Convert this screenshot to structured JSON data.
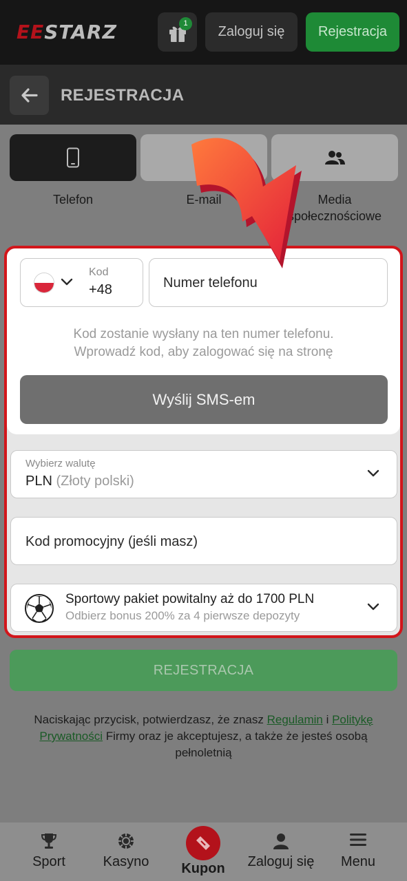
{
  "topbar": {
    "logo_red": "EE",
    "logo_text": "STARZ",
    "gift_badge": "1",
    "login_label": "Zaloguj się",
    "register_label": "Rejestracja"
  },
  "header": {
    "title": "REJESTRACJA"
  },
  "tabs": [
    {
      "label": "Telefon",
      "icon": "phone-icon",
      "active": true
    },
    {
      "label": "E-mail",
      "icon": "envelope-icon",
      "active": false
    },
    {
      "label": "Media społecznościowe",
      "label_line1": "Media",
      "label_line2": "społecznościowe",
      "icon": "users-icon",
      "active": false
    }
  ],
  "phone_form": {
    "country_flag": "flag-pl-icon",
    "code_label": "Kod",
    "code_value": "+48",
    "phone_placeholder": "Numer telefonu",
    "hint_line1": "Kod zostanie wysłany na ten numer telefonu.",
    "hint_line2": "Wprowadź kod, aby zalogować się na stronę",
    "sms_button": "Wyślij SMS-em"
  },
  "currency": {
    "label": "Wybierz walutę",
    "value_code": "PLN",
    "value_name": "(Złoty polski)"
  },
  "promo": {
    "placeholder": "Kod promocyjny (jeśli masz)"
  },
  "bonus": {
    "title": "Sportowy pakiet powitalny aż do 1700 PLN",
    "subtitle": "Odbierz bonus 200% za 4 pierwsze depozyty"
  },
  "submit": {
    "label": "REJESTRACJA"
  },
  "legal": {
    "text_before": "Naciskając przycisk, potwierdzasz, że znasz ",
    "link_terms": "Regulamin",
    "text_and": " i ",
    "link_privacy": "Politykę Prywatności",
    "text_after": " Firmy oraz je akceptujesz, a także że jesteś osobą pełnoletnią"
  },
  "bottom_nav": [
    {
      "label": "Sport",
      "icon": "trophy-icon"
    },
    {
      "label": "Kasyno",
      "icon": "casino-chip-icon"
    },
    {
      "label": "Kupon",
      "icon": "ticket-icon"
    },
    {
      "label": "Zaloguj się",
      "icon": "user-icon"
    },
    {
      "label": "Menu",
      "icon": "hamburger-icon"
    }
  ],
  "colors": {
    "brand_red": "#b3121b",
    "brand_green": "#1e8a36",
    "highlight_red": "#d2161b",
    "arrow": "#f04a3a"
  }
}
